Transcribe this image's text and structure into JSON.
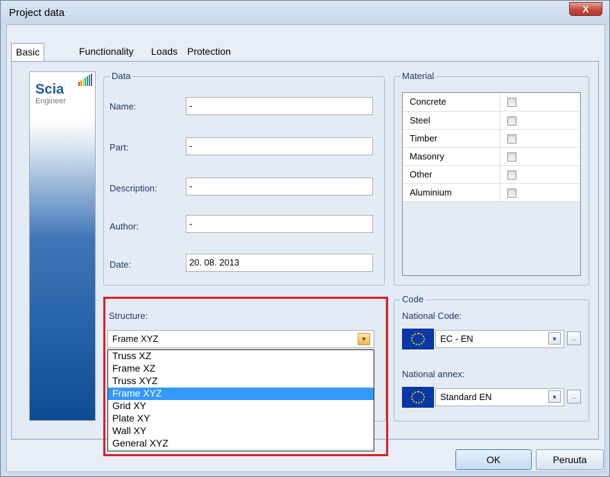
{
  "window": {
    "title": "Project data",
    "close_label": "X"
  },
  "tabs": [
    {
      "label": "Basic data"
    },
    {
      "label": "Functionality"
    },
    {
      "label": "Loads"
    },
    {
      "label": "Protection"
    }
  ],
  "logo": {
    "text": "Scia",
    "subtext": "Engineer"
  },
  "data_group": {
    "legend": "Data",
    "fields": {
      "name": {
        "label": "Name:",
        "value": "-"
      },
      "part": {
        "label": "Part:",
        "value": "-"
      },
      "description": {
        "label": "Description:",
        "value": "-"
      },
      "author": {
        "label": "Author:",
        "value": "-"
      },
      "date": {
        "label": "Date:",
        "value": "20. 08. 2013"
      }
    }
  },
  "material_group": {
    "legend": "Material",
    "items": [
      {
        "label": "Concrete",
        "checked": false
      },
      {
        "label": "Steel",
        "checked": false
      },
      {
        "label": "Timber",
        "checked": false
      },
      {
        "label": "Masonry",
        "checked": false
      },
      {
        "label": "Other",
        "checked": false
      },
      {
        "label": "Aluminium",
        "checked": false
      }
    ]
  },
  "structure": {
    "label": "Structure:",
    "selected": "Frame XYZ",
    "options": [
      "Truss XZ",
      "Frame XZ",
      "Truss XYZ",
      "Frame XYZ",
      "Grid XY",
      "Plate XY",
      "Wall XY",
      "General XYZ"
    ]
  },
  "code_group": {
    "legend": "Code",
    "national_code": {
      "label": "National Code:",
      "value": "EC - EN",
      "more": "..."
    },
    "national_annex": {
      "label": "National annex:",
      "value": "Standard EN",
      "more": "..."
    }
  },
  "buttons": {
    "ok": "OK",
    "cancel": "Peruuta"
  },
  "colors": {
    "highlight": "#e01b22",
    "selection": "#3399ff",
    "accent": "#1e3a6b"
  }
}
